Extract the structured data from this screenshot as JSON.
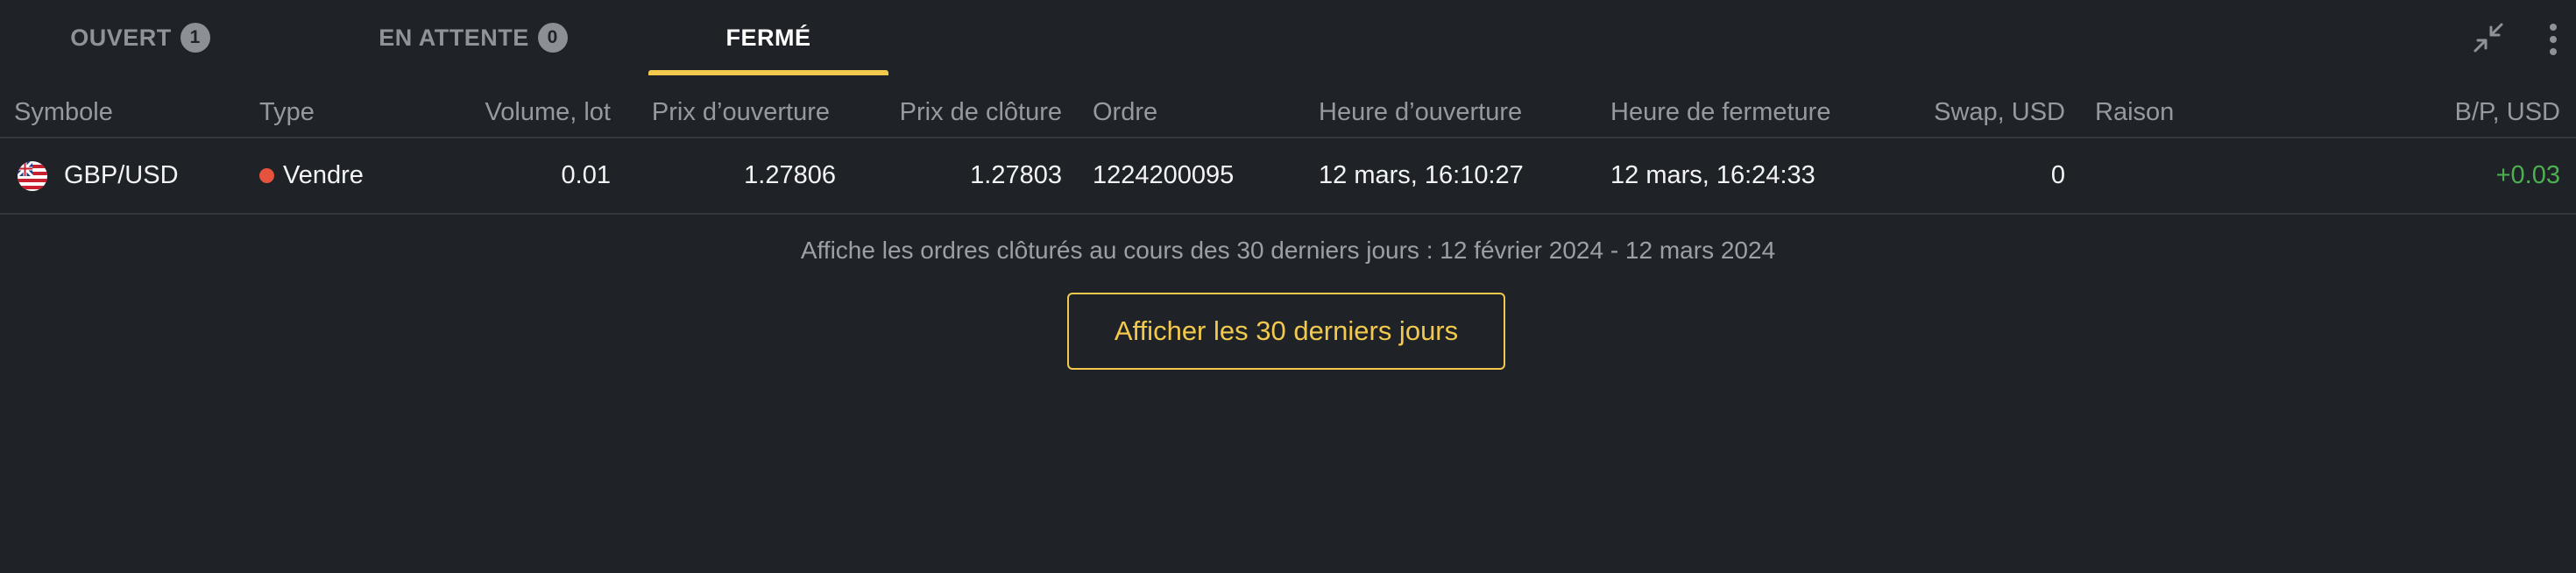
{
  "tabs": [
    {
      "label": "OUVERT",
      "badge": "1"
    },
    {
      "label": "EN ATTENTE",
      "badge": "0"
    },
    {
      "label": "FERMÉ"
    }
  ],
  "active_tab": "FERMÉ",
  "toolbar_icons": [
    "collapse-icon",
    "more-vertical-icon"
  ],
  "accent_color": "#f2c94c",
  "table": {
    "columns": [
      "Symbole",
      "Type",
      "Volume, lot",
      "Prix d’ouverture",
      "Prix de clôture",
      "Ordre",
      "Heure d’ouverture",
      "Heure de fermeture",
      "Swap, USD",
      "Raison",
      "B/P, USD"
    ],
    "rows": [
      {
        "symbol": "GBP/USD",
        "type": "Vendre",
        "volume": "0.01",
        "open_price": "1.27806",
        "close_price": "1.27803",
        "order": "1224200095",
        "open_time": "12 mars, 16:10:27",
        "close_time": "12 mars, 16:24:33",
        "swap": "0",
        "reason": "",
        "pnl": "+0.03"
      }
    ]
  },
  "footer": {
    "note": "Affiche les ordres clôturés au cours des 30 derniers jours : 12 février 2024 - 12 mars 2024",
    "button_label": "Afficher les 30 derniers jours"
  }
}
